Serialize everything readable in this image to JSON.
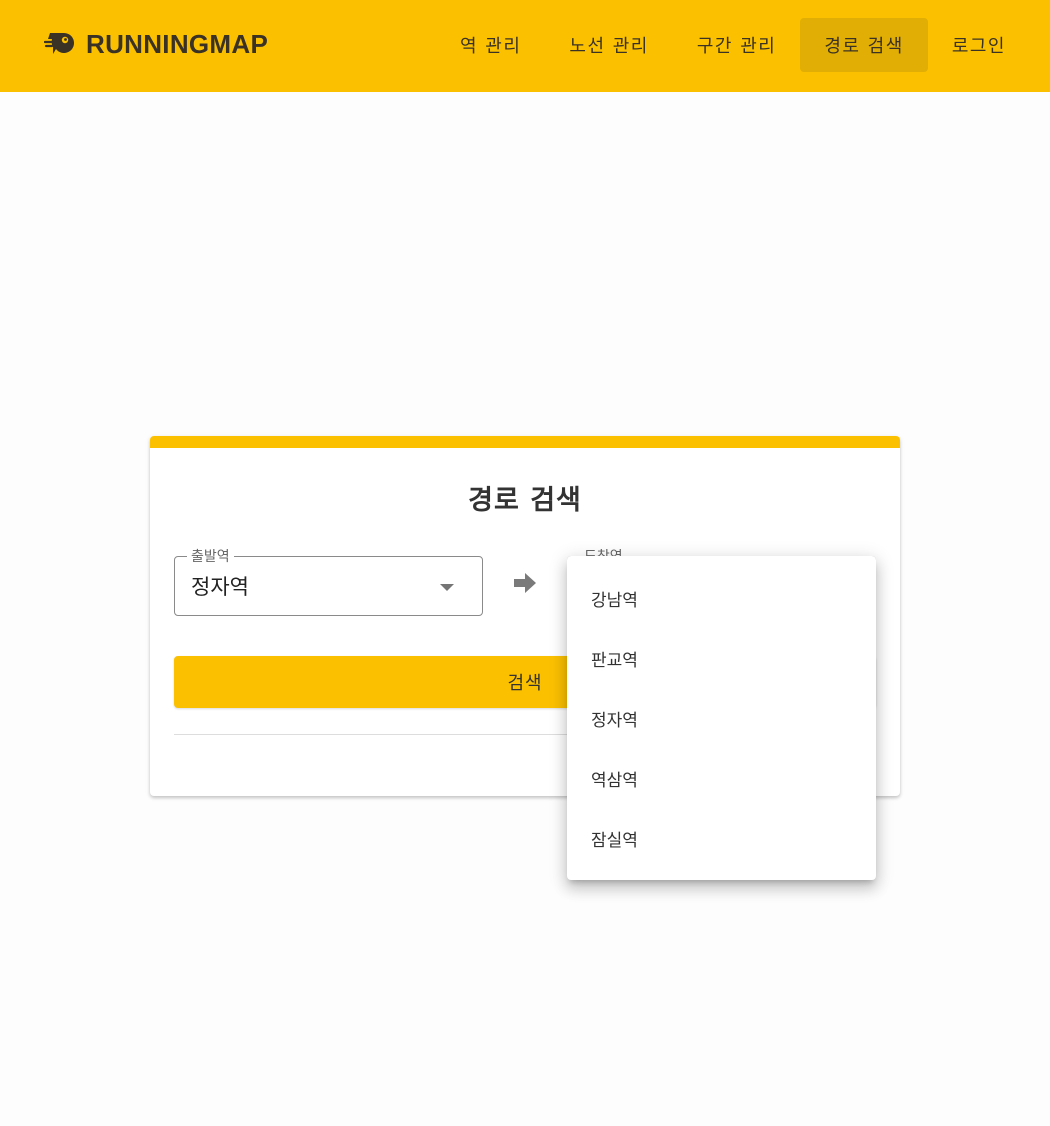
{
  "app": {
    "brand": "RUNNINGMAP",
    "logo_icon": "running-bird-logo"
  },
  "nav": {
    "items": [
      {
        "label": "역 관리",
        "active": false
      },
      {
        "label": "노선 관리",
        "active": false
      },
      {
        "label": "구간 관리",
        "active": false
      },
      {
        "label": "경로 검색",
        "active": true
      },
      {
        "label": "로그인",
        "active": false
      }
    ]
  },
  "search_card": {
    "title": "경로 검색",
    "departure": {
      "label": "출발역",
      "value": "정자역"
    },
    "arrival": {
      "label": "도착역",
      "value": ""
    },
    "search_button": "검색"
  },
  "arrival_menu": {
    "options": [
      "강남역",
      "판교역",
      "정자역",
      "역삼역",
      "잠실역"
    ]
  },
  "colors": {
    "accent": "#fbc100",
    "nav_active": "#e0ae04",
    "text_dark": "#3a3225"
  }
}
